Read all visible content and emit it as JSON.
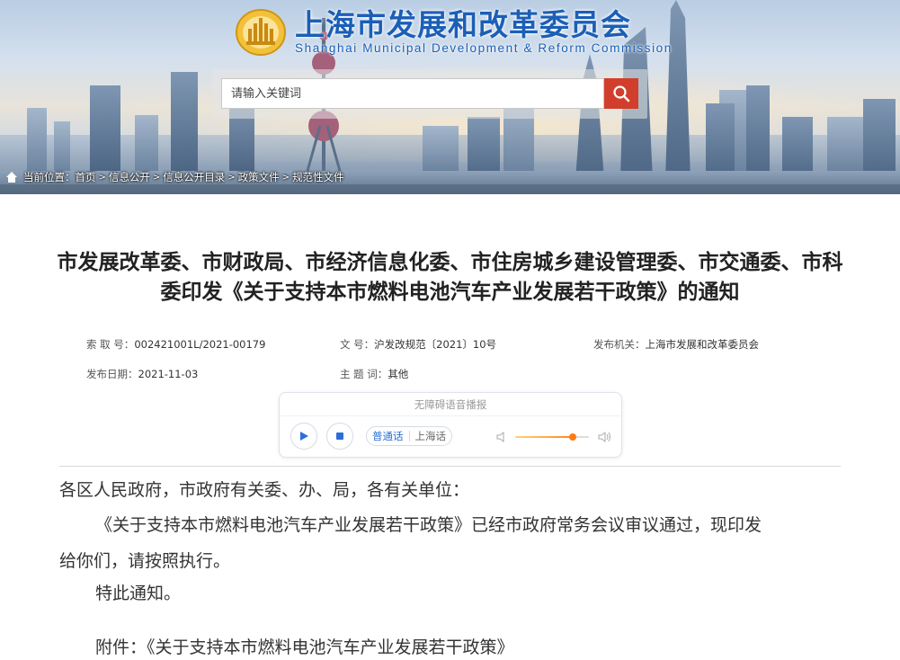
{
  "site": {
    "name_cn": "上海市发展和改革委员会",
    "name_en": "Shanghai Municipal Development & Reform Commission"
  },
  "search": {
    "placeholder": "请输入关键词",
    "button_icon": "search-icon"
  },
  "breadcrumb": {
    "prefix": "当前位置：",
    "items": [
      "首页",
      "信息公开",
      "信息公开目录",
      "政策文件",
      "规范性文件"
    ],
    "separator": ">"
  },
  "article": {
    "title_line1": "市发展改革委、市财政局、市经济信息化委、市住房城乡建设管理委、市交通委、市科",
    "title_line2": "委印发《关于支持本市燃料电池汽车产业发展若干政策》的通知",
    "meta": {
      "index_label": "索 取 号：",
      "index_value": "002421001L/2021-00179",
      "doc_no_label": "文 号：",
      "doc_no_value": "沪发改规范〔2021〕10号",
      "publisher_label": "发布机关：",
      "publisher_value": "上海市发展和改革委员会",
      "date_label": "发布日期：",
      "date_value": "2021-11-03",
      "subject_label": "主 题 词：",
      "subject_value": "其他"
    },
    "body": {
      "salutation": "各区人民政府，市政府有关委、办、局，各有关单位：",
      "para1_line1": "《关于支持本市燃料电池汽车产业发展若干政策》已经市政府常务会议审议通过，现印发",
      "para1_line2": "给你们，请按照执行。",
      "para2": "特此通知。",
      "attachment": "附件：《关于支持本市燃料电池汽车产业发展若干政策》"
    }
  },
  "player": {
    "title": "无障碍语音播报",
    "languages": [
      "普通话",
      "上海话"
    ],
    "selected_language": "普通话",
    "volume": 0.78,
    "accent_color": "#2b6fd6",
    "volume_color": "#ff7a12"
  },
  "colors": {
    "brand_blue": "#1b5fb6",
    "search_button": "#d13f2c"
  }
}
